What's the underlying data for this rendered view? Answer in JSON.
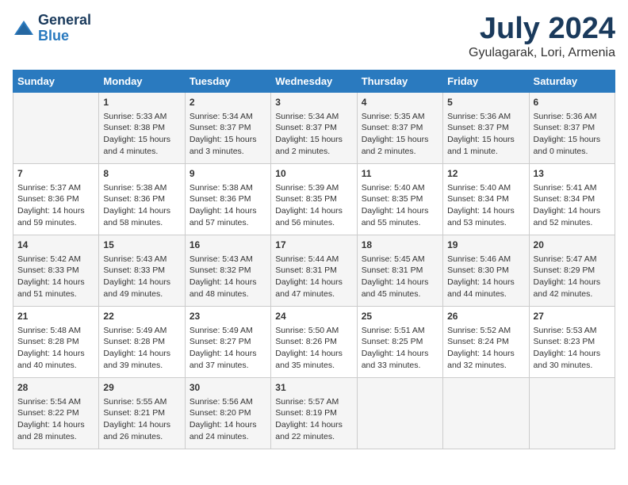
{
  "header": {
    "logo_line1": "General",
    "logo_line2": "Blue",
    "month_title": "July 2024",
    "location": "Gyulagarak, Lori, Armenia"
  },
  "weekdays": [
    "Sunday",
    "Monday",
    "Tuesday",
    "Wednesday",
    "Thursday",
    "Friday",
    "Saturday"
  ],
  "weeks": [
    [
      {
        "day": "",
        "content": ""
      },
      {
        "day": "1",
        "content": "Sunrise: 5:33 AM\nSunset: 8:38 PM\nDaylight: 15 hours\nand 4 minutes."
      },
      {
        "day": "2",
        "content": "Sunrise: 5:34 AM\nSunset: 8:37 PM\nDaylight: 15 hours\nand 3 minutes."
      },
      {
        "day": "3",
        "content": "Sunrise: 5:34 AM\nSunset: 8:37 PM\nDaylight: 15 hours\nand 2 minutes."
      },
      {
        "day": "4",
        "content": "Sunrise: 5:35 AM\nSunset: 8:37 PM\nDaylight: 15 hours\nand 2 minutes."
      },
      {
        "day": "5",
        "content": "Sunrise: 5:36 AM\nSunset: 8:37 PM\nDaylight: 15 hours\nand 1 minute."
      },
      {
        "day": "6",
        "content": "Sunrise: 5:36 AM\nSunset: 8:37 PM\nDaylight: 15 hours\nand 0 minutes."
      }
    ],
    [
      {
        "day": "7",
        "content": "Sunrise: 5:37 AM\nSunset: 8:36 PM\nDaylight: 14 hours\nand 59 minutes."
      },
      {
        "day": "8",
        "content": "Sunrise: 5:38 AM\nSunset: 8:36 PM\nDaylight: 14 hours\nand 58 minutes."
      },
      {
        "day": "9",
        "content": "Sunrise: 5:38 AM\nSunset: 8:36 PM\nDaylight: 14 hours\nand 57 minutes."
      },
      {
        "day": "10",
        "content": "Sunrise: 5:39 AM\nSunset: 8:35 PM\nDaylight: 14 hours\nand 56 minutes."
      },
      {
        "day": "11",
        "content": "Sunrise: 5:40 AM\nSunset: 8:35 PM\nDaylight: 14 hours\nand 55 minutes."
      },
      {
        "day": "12",
        "content": "Sunrise: 5:40 AM\nSunset: 8:34 PM\nDaylight: 14 hours\nand 53 minutes."
      },
      {
        "day": "13",
        "content": "Sunrise: 5:41 AM\nSunset: 8:34 PM\nDaylight: 14 hours\nand 52 minutes."
      }
    ],
    [
      {
        "day": "14",
        "content": "Sunrise: 5:42 AM\nSunset: 8:33 PM\nDaylight: 14 hours\nand 51 minutes."
      },
      {
        "day": "15",
        "content": "Sunrise: 5:43 AM\nSunset: 8:33 PM\nDaylight: 14 hours\nand 49 minutes."
      },
      {
        "day": "16",
        "content": "Sunrise: 5:43 AM\nSunset: 8:32 PM\nDaylight: 14 hours\nand 48 minutes."
      },
      {
        "day": "17",
        "content": "Sunrise: 5:44 AM\nSunset: 8:31 PM\nDaylight: 14 hours\nand 47 minutes."
      },
      {
        "day": "18",
        "content": "Sunrise: 5:45 AM\nSunset: 8:31 PM\nDaylight: 14 hours\nand 45 minutes."
      },
      {
        "day": "19",
        "content": "Sunrise: 5:46 AM\nSunset: 8:30 PM\nDaylight: 14 hours\nand 44 minutes."
      },
      {
        "day": "20",
        "content": "Sunrise: 5:47 AM\nSunset: 8:29 PM\nDaylight: 14 hours\nand 42 minutes."
      }
    ],
    [
      {
        "day": "21",
        "content": "Sunrise: 5:48 AM\nSunset: 8:28 PM\nDaylight: 14 hours\nand 40 minutes."
      },
      {
        "day": "22",
        "content": "Sunrise: 5:49 AM\nSunset: 8:28 PM\nDaylight: 14 hours\nand 39 minutes."
      },
      {
        "day": "23",
        "content": "Sunrise: 5:49 AM\nSunset: 8:27 PM\nDaylight: 14 hours\nand 37 minutes."
      },
      {
        "day": "24",
        "content": "Sunrise: 5:50 AM\nSunset: 8:26 PM\nDaylight: 14 hours\nand 35 minutes."
      },
      {
        "day": "25",
        "content": "Sunrise: 5:51 AM\nSunset: 8:25 PM\nDaylight: 14 hours\nand 33 minutes."
      },
      {
        "day": "26",
        "content": "Sunrise: 5:52 AM\nSunset: 8:24 PM\nDaylight: 14 hours\nand 32 minutes."
      },
      {
        "day": "27",
        "content": "Sunrise: 5:53 AM\nSunset: 8:23 PM\nDaylight: 14 hours\nand 30 minutes."
      }
    ],
    [
      {
        "day": "28",
        "content": "Sunrise: 5:54 AM\nSunset: 8:22 PM\nDaylight: 14 hours\nand 28 minutes."
      },
      {
        "day": "29",
        "content": "Sunrise: 5:55 AM\nSunset: 8:21 PM\nDaylight: 14 hours\nand 26 minutes."
      },
      {
        "day": "30",
        "content": "Sunrise: 5:56 AM\nSunset: 8:20 PM\nDaylight: 14 hours\nand 24 minutes."
      },
      {
        "day": "31",
        "content": "Sunrise: 5:57 AM\nSunset: 8:19 PM\nDaylight: 14 hours\nand 22 minutes."
      },
      {
        "day": "",
        "content": ""
      },
      {
        "day": "",
        "content": ""
      },
      {
        "day": "",
        "content": ""
      }
    ]
  ]
}
